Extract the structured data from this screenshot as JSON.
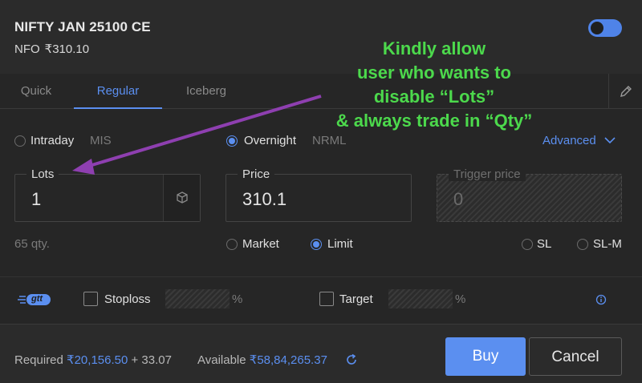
{
  "header": {
    "title": "NIFTY JAN 25100 CE",
    "exchange": "NFO",
    "price": "₹310.10",
    "toggle_on": true
  },
  "tabs": [
    {
      "label": "Quick",
      "active": false
    },
    {
      "label": "Regular",
      "active": true
    },
    {
      "label": "Iceberg",
      "active": false
    }
  ],
  "product": {
    "intraday_label": "Intraday",
    "intraday_code": "MIS",
    "overnight_label": "Overnight",
    "overnight_code": "NRML",
    "selected": "Overnight",
    "advanced_label": "Advanced"
  },
  "fields": {
    "lots_label": "Lots",
    "lots_value": "1",
    "qty_hint": "65 qty.",
    "price_label": "Price",
    "price_value": "310.1",
    "trigger_label": "Trigger price",
    "trigger_value": "0"
  },
  "order_type": {
    "market": "Market",
    "limit": "Limit",
    "sl": "SL",
    "slm": "SL-M",
    "selected": "Limit"
  },
  "gtt": {
    "badge": "gtt",
    "stoploss_label": "Stoploss",
    "target_label": "Target",
    "percent": "%"
  },
  "footer": {
    "required_label": "Required",
    "required_value": "₹20,156.50",
    "required_extra": "+ 33.07",
    "available_label": "Available",
    "available_value": "₹58,84,265.37",
    "buy_label": "Buy",
    "cancel_label": "Cancel"
  },
  "annotation": {
    "lines": [
      "Kindly allow",
      "user who wants to",
      "disable “Lots”",
      "& always trade in “Qty”"
    ],
    "color": "#4cd94c",
    "arrow_color": "#8e3fb0"
  },
  "colors": {
    "accent": "#5b8ff0",
    "background": "#262626"
  }
}
